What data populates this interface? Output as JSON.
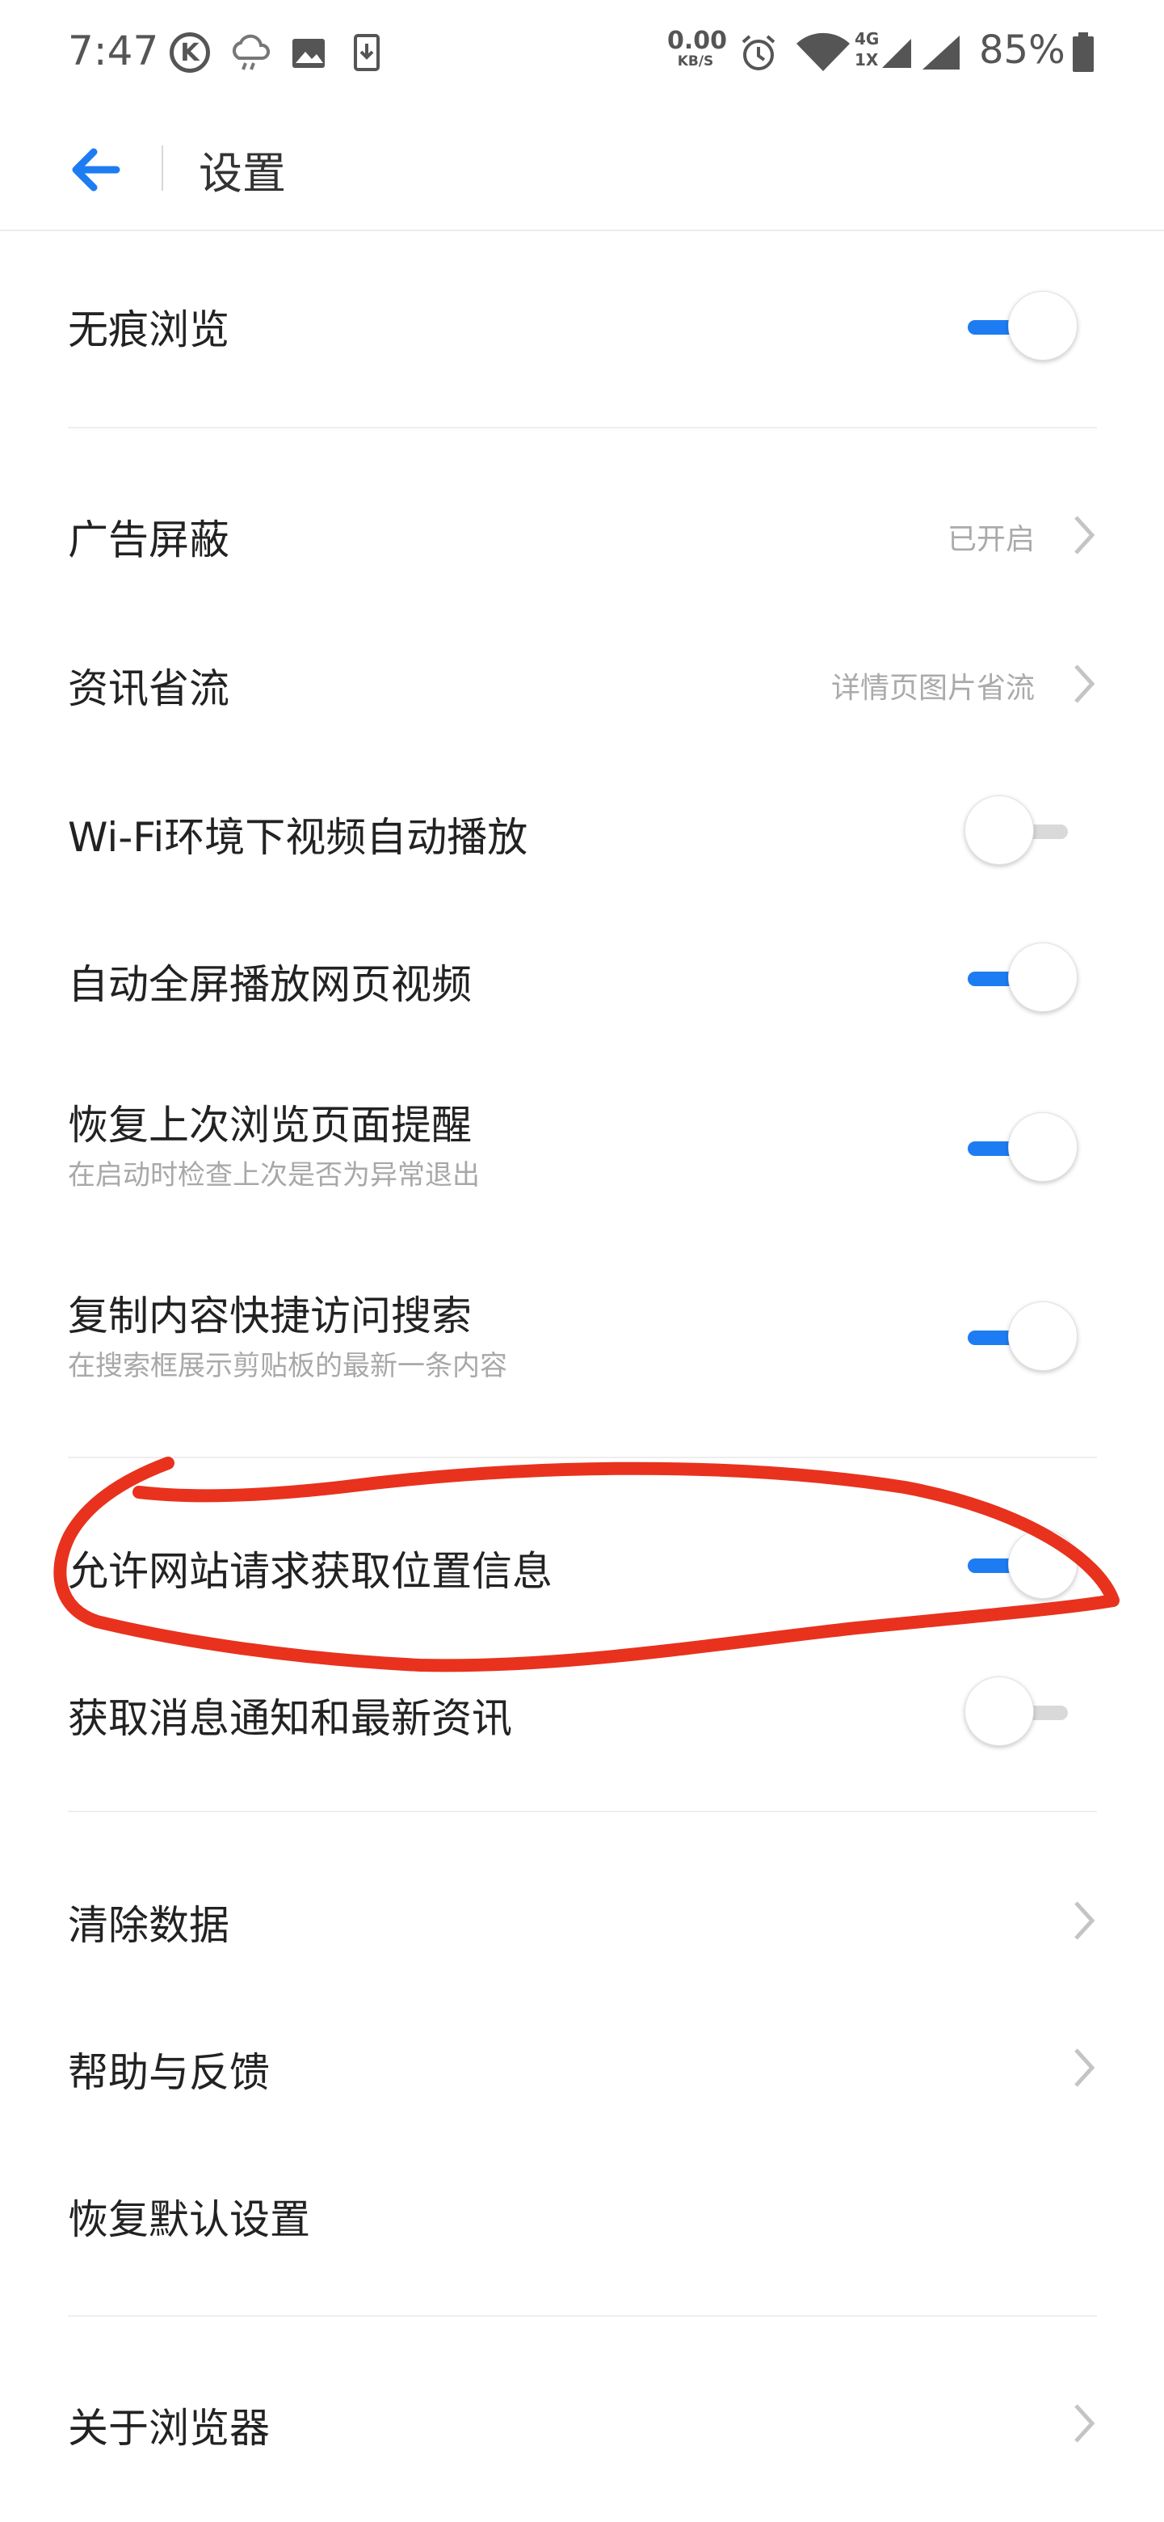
{
  "status_bar": {
    "time": "7:47",
    "k_badge": "K",
    "net_speed_value": "0.00",
    "net_speed_unit": "KB/S",
    "net_type_top": "4G",
    "net_type_bottom": "1X",
    "battery": "85%"
  },
  "header": {
    "title": "设置"
  },
  "settings": {
    "incognito": {
      "label": "无痕浏览",
      "enabled": true
    },
    "ad_block": {
      "label": "广告屏蔽",
      "value": "已开启"
    },
    "data_saver": {
      "label": "资讯省流",
      "value": "详情页图片省流"
    },
    "wifi_autoplay": {
      "label": "Wi-Fi环境下视频自动播放",
      "enabled": false
    },
    "auto_fullscreen": {
      "label": "自动全屏播放网页视频",
      "enabled": true
    },
    "restore_reminder": {
      "label": "恢复上次浏览页面提醒",
      "sub": "在启动时检查上次是否为异常退出",
      "enabled": true
    },
    "clipboard_search": {
      "label": "复制内容快捷访问搜索",
      "sub": "在搜索框展示剪贴板的最新一条内容",
      "enabled": true
    },
    "location_permission": {
      "label": "允许网站请求获取位置信息",
      "enabled": true
    },
    "notifications": {
      "label": "获取消息通知和最新资讯",
      "enabled": false
    },
    "clear_data": {
      "label": "清除数据"
    },
    "help_feedback": {
      "label": "帮助与反馈"
    },
    "reset_defaults": {
      "label": "恢复默认设置"
    },
    "about": {
      "label": "关于浏览器"
    }
  },
  "colors": {
    "accent": "#1e7cf2",
    "annotation": "#e8321e"
  }
}
